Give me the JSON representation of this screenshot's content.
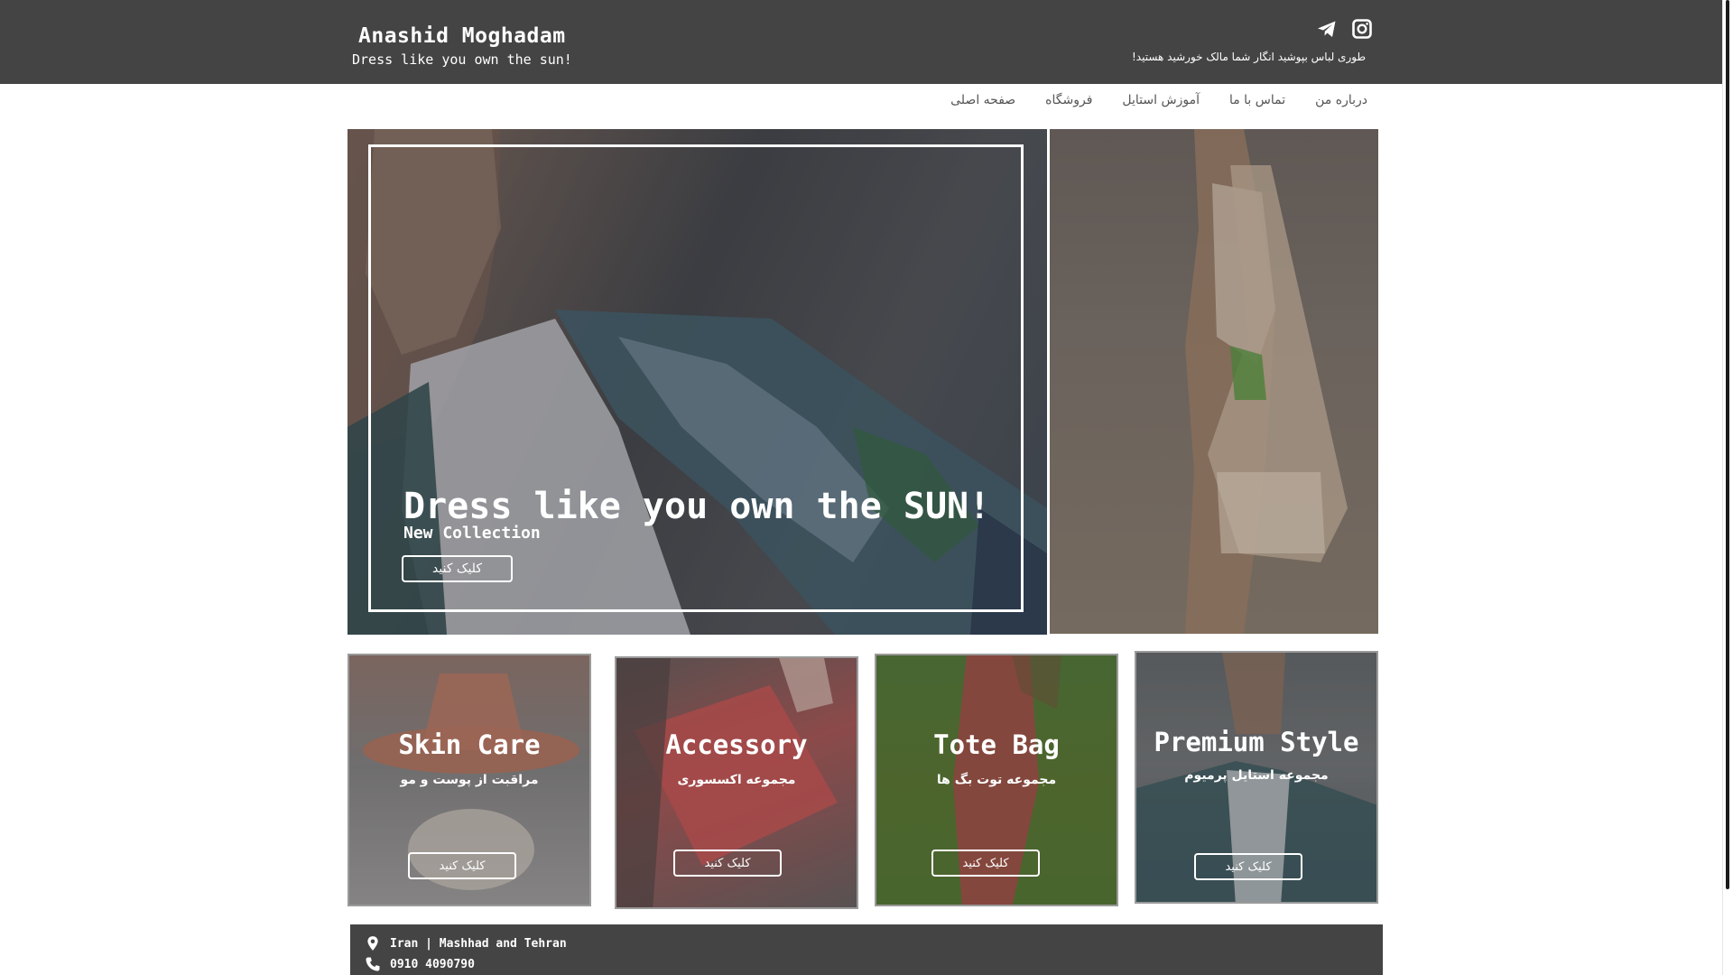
{
  "header": {
    "brand_name": "Anashid Moghadam",
    "brand_tagline": "Dress like you own the sun!",
    "tagline_fa": "طوری لباس بپوشید انگار شما مالک خورشید هستید!",
    "icons": [
      "telegram-icon",
      "instagram-icon"
    ]
  },
  "nav": {
    "items": [
      "صفحه اصلی",
      "فروشگاه",
      "آموزش استایل",
      "تماس با ما",
      "درباره من"
    ]
  },
  "hero": {
    "title": "Dress like you own the SUN!",
    "subtitle": "New Collection",
    "button_label": "کلیک کنید"
  },
  "cards": [
    {
      "title": "Skin Care",
      "subtitle": "مراقبت از پوست و مو",
      "button_label": "کلیک کنید"
    },
    {
      "title": "Accessory",
      "subtitle": "مجموعه اکسسوری",
      "button_label": "کلیک کنید"
    },
    {
      "title": "Tote Bag",
      "subtitle": "مجموعه توت بگ ها",
      "button_label": "کلیک کنید"
    },
    {
      "title": "Premium Style",
      "subtitle": "مجموعه استایل  پرمیوم",
      "button_label": "کلیک کنید"
    }
  ],
  "footer": {
    "address": "Iran | Mashhad and Tehran",
    "phone": "0910 4090790",
    "icons": [
      "location-pin-icon",
      "phone-icon"
    ]
  },
  "colors": {
    "header_bg": "#444444",
    "text_on_dark": "#ffffff",
    "nav_text": "#555555"
  }
}
